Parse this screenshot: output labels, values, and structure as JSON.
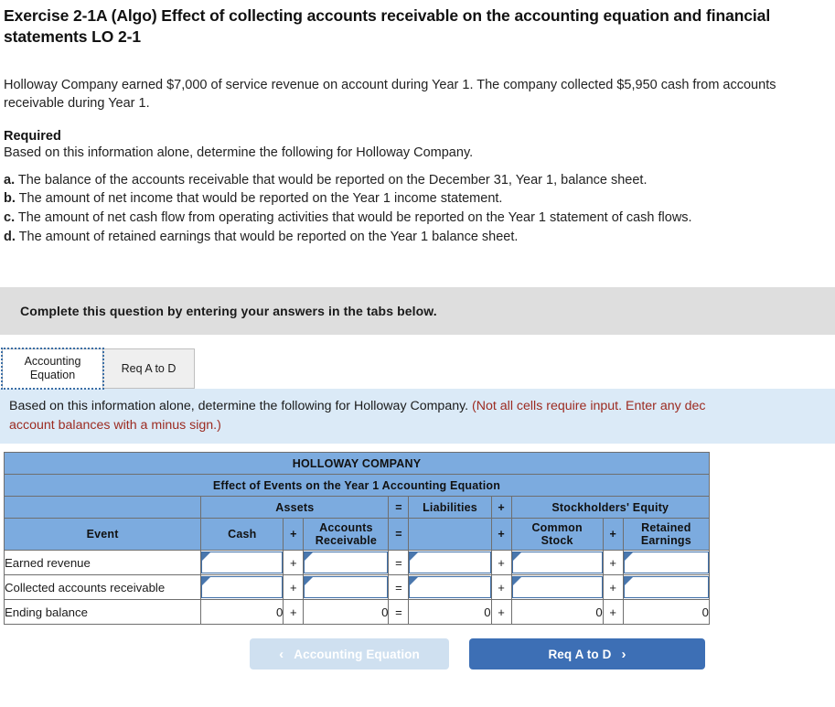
{
  "question": {
    "title": "Exercise 2-1A (Algo) Effect of collecting accounts receivable on the accounting equation and financial statements LO 2-1",
    "scenario": "Holloway Company earned $7,000 of service revenue on account during Year 1. The company collected $5,950 cash from accounts receivable during Year 1.",
    "required_label": "Required",
    "required_intro": "Based on this information alone, determine the following for Holloway Company.",
    "requirements": [
      {
        "marker": "a.",
        "text": "The balance of the accounts receivable that would be reported on the December 31, Year 1, balance sheet."
      },
      {
        "marker": "b.",
        "text": "The amount of net income that would be reported on the Year 1 income statement."
      },
      {
        "marker": "c.",
        "text": "The amount of net cash flow from operating activities that would be reported on the Year 1 statement of cash flows."
      },
      {
        "marker": "d.",
        "text": "The amount of retained earnings that would be reported on the Year 1 balance sheet."
      }
    ]
  },
  "callout": {
    "text": "Complete this question by entering your answers in the tabs below."
  },
  "tabs": [
    {
      "label_line1": "Accounting",
      "label_line2": "Equation",
      "state": "active"
    },
    {
      "label_line1": "Req A to D",
      "label_line2": "",
      "state": "inactive"
    }
  ],
  "info_band": {
    "main_text": "Based on this information alone, determine the following for Holloway Company. ",
    "hint_text": "(Not all cells require input. Enter any dec",
    "hint_text_line2": "account balances with a minus sign.)"
  },
  "worksheet": {
    "company": "HOLLOWAY COMPANY",
    "subtitle": "Effect of Events on the Year 1 Accounting Equation",
    "group_headers": {
      "blank": "",
      "assets": "Assets",
      "eq1": "=",
      "liabilities": "Liabilities",
      "plus1": "+",
      "stockholders_equity": "Stockholders' Equity"
    },
    "column_headers": {
      "event": "Event",
      "cash": "Cash",
      "plus_a": "+",
      "accounts_receivable": "Accounts Receivable",
      "accounts_receivable_l1": "Accounts",
      "accounts_receivable_l2": "Receivable",
      "eq": "=",
      "liabilities": "",
      "plus_b": "+",
      "common_stock_l1": "Common",
      "common_stock_l2": "Stock",
      "plus_c": "+",
      "retained_earnings_l1": "Retained",
      "retained_earnings_l2": "Earnings"
    },
    "rows": [
      {
        "label": "Earned revenue",
        "cash": "",
        "op1": "+",
        "ar": "",
        "op2": "=",
        "liab": "",
        "op3": "+",
        "cs": "",
        "op4": "+",
        "re": "",
        "type": "input"
      },
      {
        "label": "Collected accounts receivable",
        "cash": "",
        "op1": "+",
        "ar": "",
        "op2": "=",
        "liab": "",
        "op3": "+",
        "cs": "",
        "op4": "+",
        "re": "",
        "type": "input"
      },
      {
        "label": "Ending balance",
        "cash": "0",
        "op1": "+",
        "ar": "0",
        "op2": "=",
        "liab": "0",
        "op3": "+",
        "cs": "0",
        "op4": "+",
        "re": "0",
        "type": "total"
      }
    ]
  },
  "footer": {
    "prev_label": "Accounting Equation",
    "prev_chevron": "‹",
    "next_label": "Req A to D",
    "next_chevron": "›"
  },
  "colors": {
    "table_header_blue": "#7cabdf",
    "info_band_blue": "#dbeaf7",
    "callout_gray": "#dedede",
    "hint_red": "#9c2b21",
    "primary_button_blue": "#3d6fb5",
    "disabled_button_blue": "#cfe0f0",
    "input_border_blue": "#3f6fa8"
  }
}
